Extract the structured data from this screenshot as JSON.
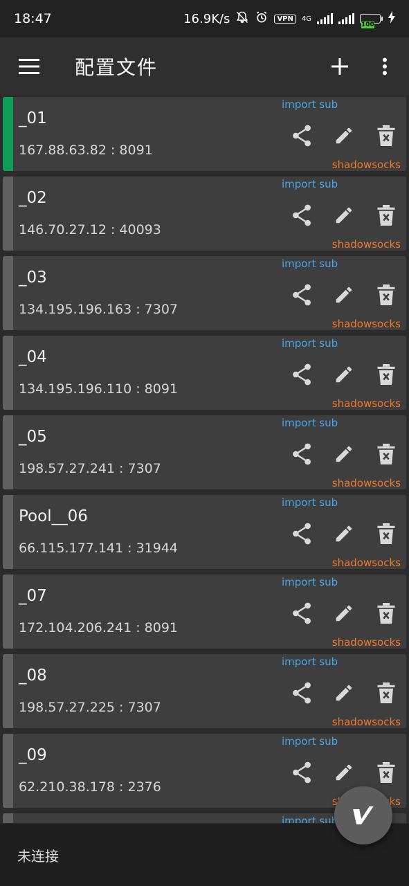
{
  "status_bar": {
    "time": "18:47",
    "speed": "16.9K/s",
    "vpn": "VPN",
    "network": "4G",
    "battery": "100"
  },
  "app_bar": {
    "title": "配置文件"
  },
  "servers": [
    {
      "name": "_01",
      "address": "167.88.63.82 : 8091",
      "sub": "import sub",
      "type": "shadowsocks",
      "active": true
    },
    {
      "name": "_02",
      "address": "146.70.27.12 : 40093",
      "sub": "import sub",
      "type": "shadowsocks",
      "active": false
    },
    {
      "name": "_03",
      "address": "134.195.196.163 : 7307",
      "sub": "import sub",
      "type": "shadowsocks",
      "active": false
    },
    {
      "name": "_04",
      "address": "134.195.196.110 : 8091",
      "sub": "import sub",
      "type": "shadowsocks",
      "active": false
    },
    {
      "name": "_05",
      "address": "198.57.27.241 : 7307",
      "sub": "import sub",
      "type": "shadowsocks",
      "active": false
    },
    {
      "name": "Pool__06",
      "address": "66.115.177.141 : 31944",
      "sub": "import sub",
      "type": "shadowsocks",
      "active": false
    },
    {
      "name": "_07",
      "address": "172.104.206.241 : 8091",
      "sub": "import sub",
      "type": "shadowsocks",
      "active": false
    },
    {
      "name": "_08",
      "address": "198.57.27.225 : 7307",
      "sub": "import sub",
      "type": "shadowsocks",
      "active": false
    },
    {
      "name": "_09",
      "address": "62.210.38.178 : 2376",
      "sub": "import sub",
      "type": "shadowsocks",
      "active": false
    },
    {
      "name": "",
      "address": "",
      "sub": "import sub",
      "type": "",
      "active": false
    }
  ],
  "bottom": {
    "status": "未连接"
  },
  "colors": {
    "accent_active": "#0f9d58",
    "sub": "#4aa6e8",
    "type": "#f0782c"
  }
}
